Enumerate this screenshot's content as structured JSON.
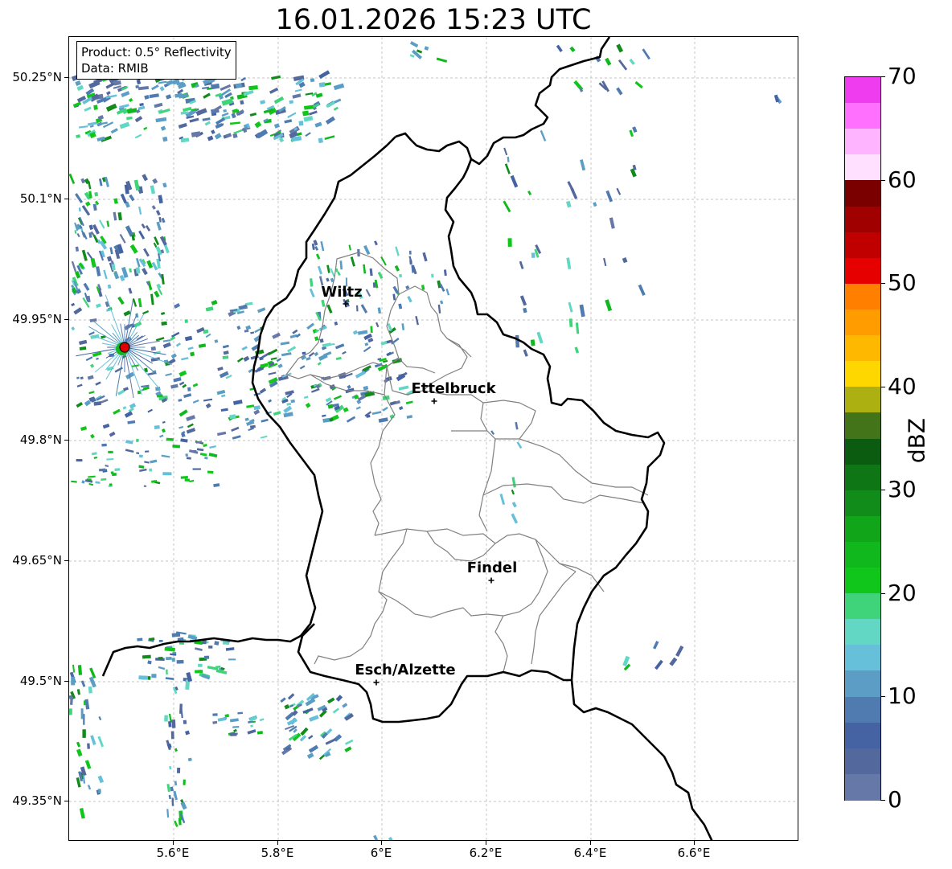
{
  "title": "16.01.2026 15:23 UTC",
  "info": {
    "product": "Product: 0.5° Reflectivity",
    "data_source": "Data: RMIB"
  },
  "axes": {
    "lat_labels": [
      "50.25°N",
      "50.1°N",
      "49.95°N",
      "49.8°N",
      "49.65°N",
      "49.5°N",
      "49.35°N"
    ],
    "lon_labels": [
      "5.6°E",
      "5.8°E",
      "6°E",
      "6.2°E",
      "6.4°E",
      "6.6°E"
    ]
  },
  "cities": [
    {
      "name": "Wiltz"
    },
    {
      "name": "Ettelbruck"
    },
    {
      "name": "Findel"
    },
    {
      "name": "Esch/Alzette"
    }
  ],
  "colorbar": {
    "label": "dBZ",
    "min": 0,
    "max": 70,
    "tick_labels": [
      "0",
      "10",
      "20",
      "30",
      "40",
      "50",
      "60",
      "70"
    ],
    "colors": [
      "#6678a8",
      "#53689d",
      "#4563a2",
      "#4f7bb1",
      "#5b9dc5",
      "#67c0d9",
      "#62d8c4",
      "#3fd47a",
      "#11c61a",
      "#11b81d",
      "#11a51a",
      "#118b1a",
      "#0e7614",
      "#0b5b11",
      "#43741a",
      "#acb011",
      "#ffd700",
      "#ffb800",
      "#ff9d00",
      "#ff7f00",
      "#e60000",
      "#c00000",
      "#a00000",
      "#7a0000",
      "#ffe0ff",
      "#ffb4ff",
      "#ff70ff",
      "#ee3cee"
    ]
  },
  "radar_site_color": "#e00000"
}
